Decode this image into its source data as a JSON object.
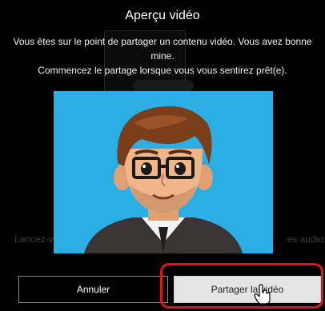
{
  "dialog": {
    "title": "Aperçu vidéo",
    "description_line1": "Vous êtes sur le point de partager un contenu vidéo. Vous avez bonne mine.",
    "description_line2": "Commencez le partage lorsque vous vous sentirez prêt(e).",
    "cancel_label": "Annuler",
    "share_label": "Partager la vidéo"
  },
  "background_hints": {
    "left": "Lancez-vo",
    "right": "es audio"
  },
  "colors": {
    "preview_background": "#2aaee3",
    "highlight": "#e0141b",
    "share_button": "#e4e4e4"
  },
  "icons": {
    "preview_image": "cartoon-avatar-icon",
    "cursor": "hand-pointer-icon"
  }
}
